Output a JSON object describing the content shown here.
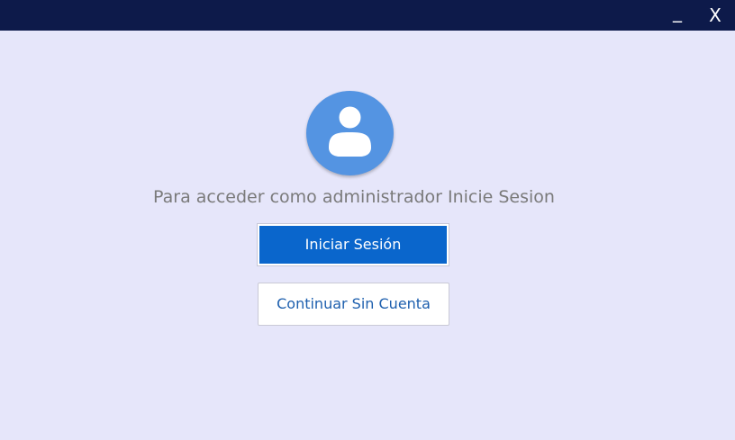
{
  "window": {
    "minimize_label": "_",
    "close_label": "X"
  },
  "login": {
    "avatar_icon": "user-icon",
    "prompt": "Para acceder como administrador Inicie Sesion",
    "signin_label": "Iniciar Sesión",
    "continue_label": "Continuar Sin Cuenta"
  },
  "colors": {
    "titlebar": "#0d1a4a",
    "background": "#e6e6fa",
    "avatar": "#5494e2",
    "primary_button": "#0a66cc",
    "secondary_text": "#1d5fae"
  }
}
